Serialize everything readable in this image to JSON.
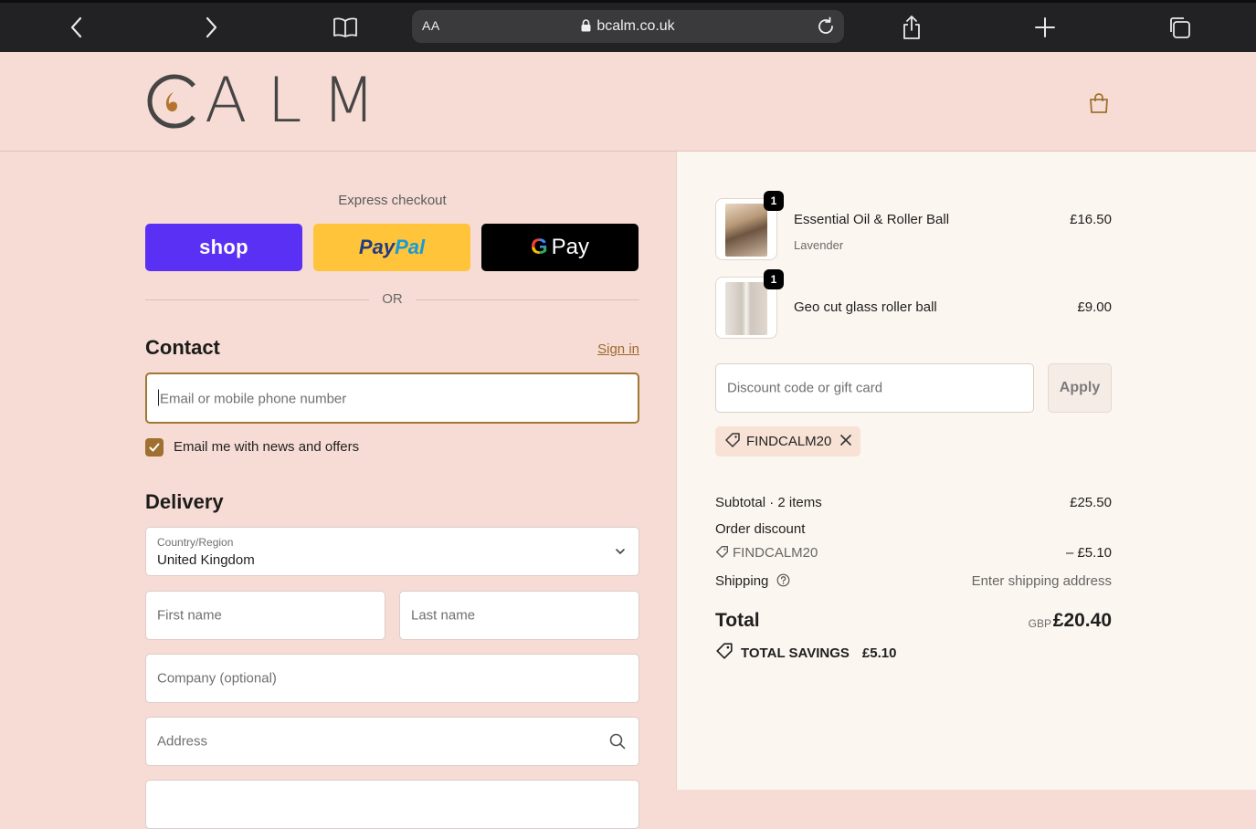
{
  "browser": {
    "text_size_label": "AA",
    "host": "bcalm.co.uk"
  },
  "brand": {
    "name": "ALM",
    "accent": "#a0702f",
    "header_bg": "#f6dcd4"
  },
  "express": {
    "title": "Express checkout",
    "shop_label": "shop",
    "paypal_part1": "Pay",
    "paypal_part2": "Pal",
    "gpay_g": "G",
    "gpay_label": "Pay",
    "or_label": "OR"
  },
  "contact": {
    "heading": "Contact",
    "sign_in": "Sign in",
    "email_placeholder": "Email or mobile phone number",
    "newsletter_label": "Email me with news and offers",
    "newsletter_checked": true
  },
  "delivery": {
    "heading": "Delivery",
    "country_label": "Country/Region",
    "country_value": "United Kingdom",
    "first_name_placeholder": "First name",
    "last_name_placeholder": "Last name",
    "company_placeholder": "Company (optional)",
    "address_placeholder": "Address"
  },
  "order": {
    "items": [
      {
        "name": "Essential Oil & Roller Ball",
        "variant": "Lavender",
        "price": "£16.50",
        "qty": "1"
      },
      {
        "name": "Geo cut glass roller ball",
        "variant": "",
        "price": "£9.00",
        "qty": "1"
      }
    ],
    "discount_placeholder": "Discount code or gift card",
    "apply_label": "Apply",
    "applied_code": "FINDCALM20"
  },
  "summary": {
    "subtotal_label": "Subtotal · 2 items",
    "subtotal_value": "£25.50",
    "order_discount_label": "Order discount",
    "discount_code": "FINDCALM20",
    "discount_value": "– £5.10",
    "shipping_label": "Shipping",
    "shipping_value": "Enter shipping address",
    "total_label": "Total",
    "total_currency": "GBP",
    "total_value": "£20.40",
    "savings_label": "TOTAL SAVINGS",
    "savings_value": "£5.10"
  }
}
